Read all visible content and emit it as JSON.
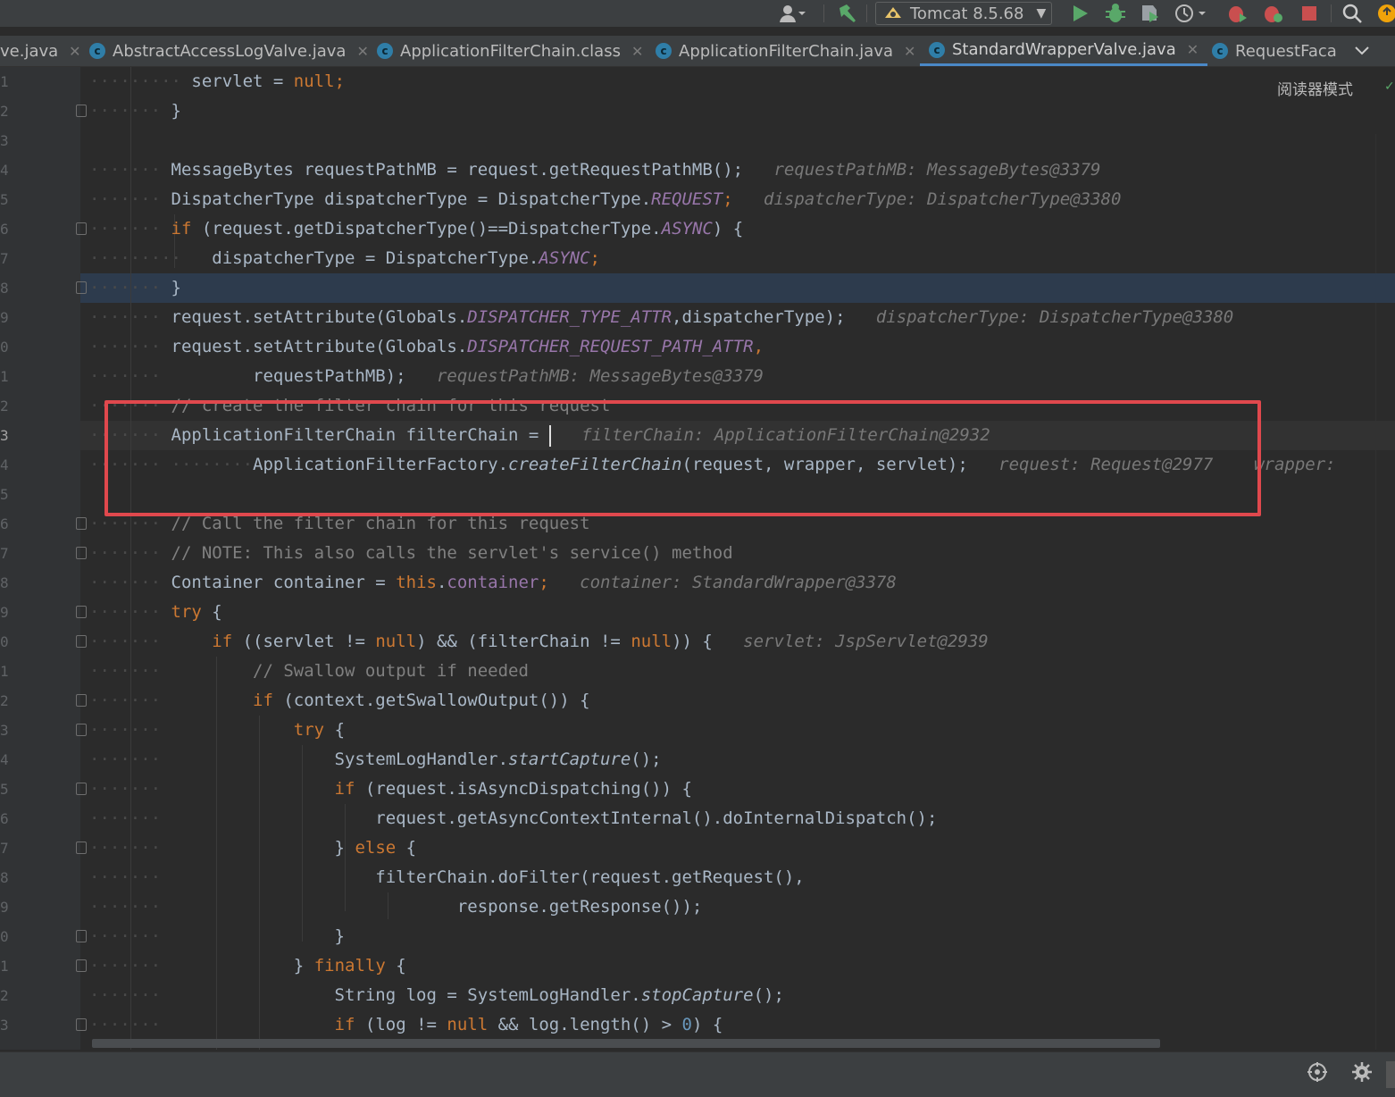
{
  "toolbar": {
    "user_icon": "user-icon",
    "build_icon": "hammer-icon",
    "run_config": "Tomcat 8.5.68",
    "icons": [
      "run-icon",
      "debug-icon",
      "coverage-icon",
      "profile-icon",
      "stop-icon",
      "search-icon",
      "update-icon"
    ]
  },
  "tabs": [
    {
      "label": "ve.java",
      "active": false
    },
    {
      "label": "AbstractAccessLogValve.java",
      "active": false
    },
    {
      "label": "ApplicationFilterChain.class",
      "active": false
    },
    {
      "label": "ApplicationFilterChain.java",
      "active": false
    },
    {
      "label": "StandardWrapperValve.java",
      "active": true
    },
    {
      "label": "RequestFaca",
      "active": false
    }
  ],
  "reader_mode": "阅读器模式",
  "line_numbers": [
    "1",
    "2",
    "3",
    "4",
    "5",
    "6",
    "7",
    "8",
    "9",
    "0",
    "1",
    "2",
    "3",
    "4",
    "5",
    "6",
    "7",
    "8",
    "9",
    "0",
    "1",
    "2",
    "3",
    "4",
    "5",
    "6",
    "7",
    "8",
    "9",
    "0",
    "1",
    "2",
    "3"
  ],
  "code": {
    "l1": [
      "servlet = ",
      "null",
      ";"
    ],
    "l2": "}",
    "l4": [
      "MessageBytes requestPathMB = request.getRequestPathMB();",
      "requestPathMB: MessageBytes@3379"
    ],
    "l5": [
      "DispatcherType dispatcherType = DispatcherType.",
      "REQUEST",
      ";",
      "dispatcherType: DispatcherType@3380"
    ],
    "l6": [
      "if",
      " (request.getDispatcherType()==DispatcherType.",
      "ASYNC",
      ") {"
    ],
    "l7": [
      "dispatcherType = DispatcherType.",
      "ASYNC",
      ";"
    ],
    "l8": "}",
    "l9": [
      "request.setAttribute(Globals.",
      "DISPATCHER_TYPE_ATTR",
      ",dispatcherType);",
      "dispatcherType: DispatcherType@3380"
    ],
    "l10": [
      "request.setAttribute(Globals.",
      "DISPATCHER_REQUEST_PATH_ATTR",
      ","
    ],
    "l11": [
      "requestPathMB);",
      "requestPathMB: MessageBytes@3379"
    ],
    "l12": "// create the filter chain for this request",
    "l13": [
      "ApplicationFilterChain filterChain = ",
      "filterChain: ApplicationFilterChain@2932"
    ],
    "l14": [
      "ApplicationFilterFactory.",
      "createFilterChain",
      "(request, wrapper, servlet);",
      "request: Request@2977",
      "wrapper:"
    ],
    "l16": "// Call the filter chain for this request",
    "l17": "// NOTE: This also calls the servlet's service() method",
    "l18": [
      "Container container = ",
      "this",
      ".",
      "container",
      ";",
      "container: StandardWrapper@3378"
    ],
    "l19": [
      "try",
      " {"
    ],
    "l20": [
      "if",
      " ((servlet != ",
      "null",
      ") && (filterChain != ",
      "null",
      ")) {",
      "servlet: JspServlet@2939"
    ],
    "l21": "// Swallow output if needed",
    "l22": [
      "if",
      " (context.getSwallowOutput()) {"
    ],
    "l23": [
      "try",
      " {"
    ],
    "l24": [
      "SystemLogHandler.",
      "startCapture",
      "();"
    ],
    "l25": [
      "if",
      " (request.isAsyncDispatching()) {"
    ],
    "l26": "request.getAsyncContextInternal().doInternalDispatch();",
    "l27": [
      "} ",
      "else",
      " {"
    ],
    "l28": "filterChain.doFilter(request.getRequest(),",
    "l29": "response.getResponse());",
    "l30": "}",
    "l31": [
      "} ",
      "finally",
      " {"
    ],
    "l32": [
      "String log = SystemLogHandler.",
      "stopCapture",
      "();"
    ],
    "l33": [
      "if",
      " (log != ",
      "null",
      " && log.length() > ",
      "0",
      ") {"
    ]
  },
  "status": {
    "icons": [
      "target-icon",
      "gear-icon"
    ]
  }
}
